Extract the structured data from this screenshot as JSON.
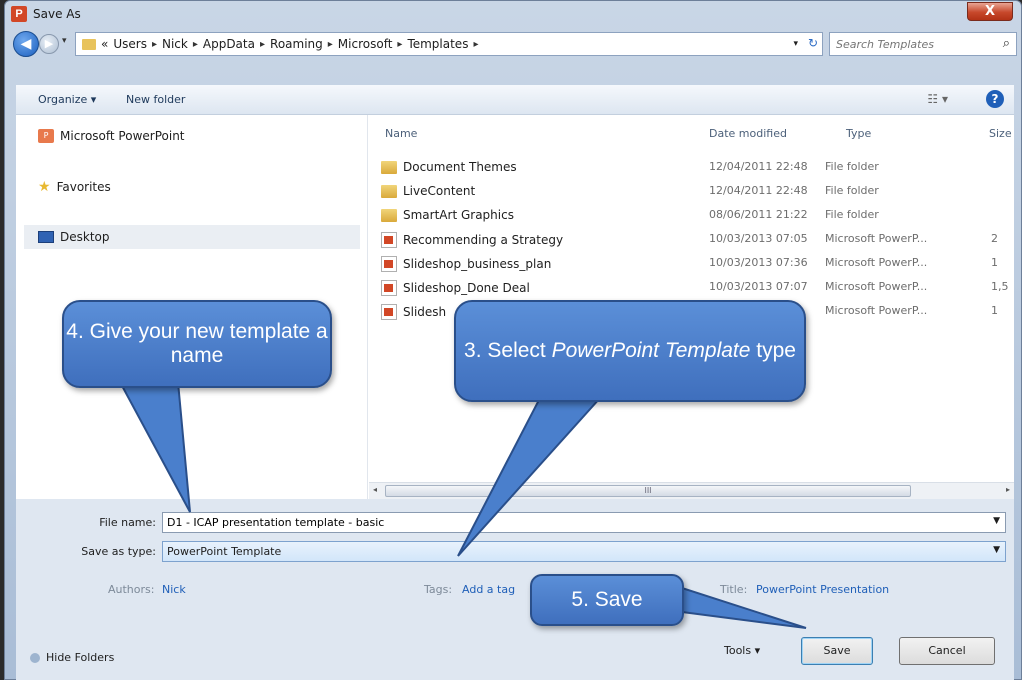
{
  "window": {
    "title": "Save As",
    "app_icon_letter": "P",
    "close_glyph": "X"
  },
  "address": {
    "crumbs": [
      "«",
      "Users",
      "Nick",
      "AppData",
      "Roaming",
      "Microsoft",
      "Templates"
    ],
    "separator": "▸",
    "search_placeholder": "Search Templates"
  },
  "toolbar": {
    "organize": "Organize ▾",
    "new_folder": "New folder",
    "help": "?"
  },
  "sidebar": {
    "items": [
      {
        "label": "Microsoft PowerPoint",
        "icon": "powerpoint-icon"
      },
      {
        "label": "Favorites",
        "icon": "star-icon"
      },
      {
        "label": "Desktop",
        "icon": "desktop-icon"
      }
    ]
  },
  "files": {
    "columns": [
      "Name",
      "Date modified",
      "Type",
      "Size"
    ],
    "rows": [
      {
        "name": "Document Themes",
        "date": "12/04/2011 22:48",
        "type": "File folder",
        "size": "",
        "icon": "folder-icon"
      },
      {
        "name": "LiveContent",
        "date": "12/04/2011 22:48",
        "type": "File folder",
        "size": "",
        "icon": "folder-icon"
      },
      {
        "name": "SmartArt Graphics",
        "date": "08/06/2011 21:22",
        "type": "File folder",
        "size": "",
        "icon": "folder-icon"
      },
      {
        "name": "Recommending a Strategy",
        "date": "10/03/2013 07:05",
        "type": "Microsoft PowerP...",
        "size": "2",
        "icon": "ppt-file-icon"
      },
      {
        "name": "Slideshop_business_plan",
        "date": "10/03/2013 07:36",
        "type": "Microsoft PowerP...",
        "size": "1",
        "icon": "ppt-file-icon"
      },
      {
        "name": "Slideshop_Done Deal",
        "date": "10/03/2013 07:07",
        "type": "Microsoft PowerP...",
        "size": "1,5",
        "icon": "ppt-file-icon"
      },
      {
        "name": "Slidesh",
        "date": "",
        "type": "Microsoft PowerP...",
        "size": "1",
        "icon": "ppt-file-icon"
      }
    ],
    "scroll_thumb": "III"
  },
  "form": {
    "file_name_label": "File name:",
    "file_name_value": "D1 - ICAP presentation template - basic",
    "save_type_label": "Save as type:",
    "save_type_value": "PowerPoint Template",
    "authors_label": "Authors:",
    "authors_value": "Nick",
    "tags_label": "Tags:",
    "tags_value": "Add a tag",
    "title_label": "Title:",
    "title_value": "PowerPoint Presentation"
  },
  "footer": {
    "hide_folders": "Hide Folders",
    "tools": "Tools ▾",
    "save": "Save",
    "cancel": "Cancel"
  },
  "callouts": {
    "name": "4. Give your new template a name",
    "type_prefix": "3. Select ",
    "type_em": "PowerPoint Template",
    "type_suffix": " type",
    "save": "5. Save"
  },
  "colors": {
    "callout_fill": "#4a7fcc",
    "accent": "#1f5fb8"
  }
}
